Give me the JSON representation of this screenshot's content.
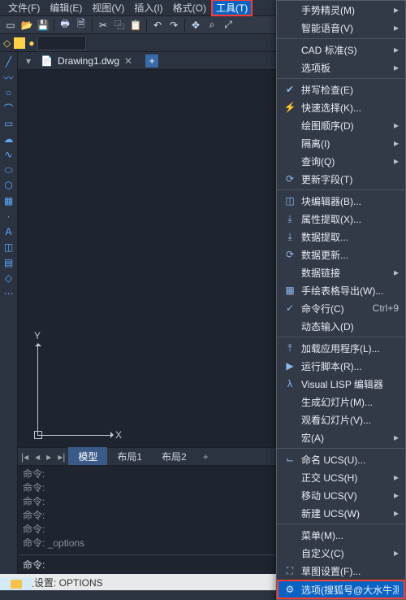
{
  "menubar": {
    "file": "文件(F)",
    "edit": "编辑(E)",
    "view": "视图(V)",
    "insert": "插入(I)",
    "format": "格式(O)",
    "tools": "工具(T)"
  },
  "file_tab": {
    "name": "Drawing1.dwg"
  },
  "axis": {
    "x": "X",
    "y": "Y"
  },
  "layout": {
    "model": "模型",
    "layout1": "布局1",
    "layout2": "布局2",
    "plus": "+"
  },
  "cmdlog": {
    "l1": "命令:",
    "l2": "命令:",
    "l3": "命令:",
    "l4": "命令:",
    "l5": "命令:",
    "l6": "命令: _options"
  },
  "cmdline": {
    "prompt": "命令:"
  },
  "statusbar": {
    "text": "自定义设置: OPTIONS"
  },
  "menu": {
    "gesture": "手势精灵(M)",
    "voice": "智能语音(V)",
    "cad_std": "CAD 标准(S)",
    "palette": "选项板",
    "spell": "拼写检查(E)",
    "qselect": "快速选择(K)...",
    "draworder": "绘图顺序(D)",
    "isolate": "隔离(I)",
    "inquiry": "查询(Q)",
    "update_fields": "更新字段(T)",
    "block_editor": "块编辑器(B)...",
    "attrib_ext": "属性提取(X)...",
    "data_ext": "数据提取...",
    "data_upd": "数据更新...",
    "data_link": "数据链接",
    "hand_table": "手绘表格导出(W)...",
    "cmdline_label": "命令行(C)",
    "cmdline_sc": "Ctrl+9",
    "dyn_input": "动态输入(D)",
    "load_app": "加载应用程序(L)...",
    "run_script": "运行脚本(R)...",
    "vlisp": "Visual LISP 编辑器",
    "make_slide": "生成幻灯片(M)...",
    "view_slide": "观看幻灯片(V)...",
    "macro": "宏(A)",
    "named_ucs": "命名 UCS(U)...",
    "ortho_ucs": "正交 UCS(H)",
    "move_ucs": "移动 UCS(V)",
    "new_ucs": "新建 UCS(W)",
    "menu_mgr": "菜单(M)...",
    "customize": "自定义(C)",
    "draft_settings": "草图设置(F)...",
    "options": "选项(搜狐号@大水牛测绘"
  }
}
